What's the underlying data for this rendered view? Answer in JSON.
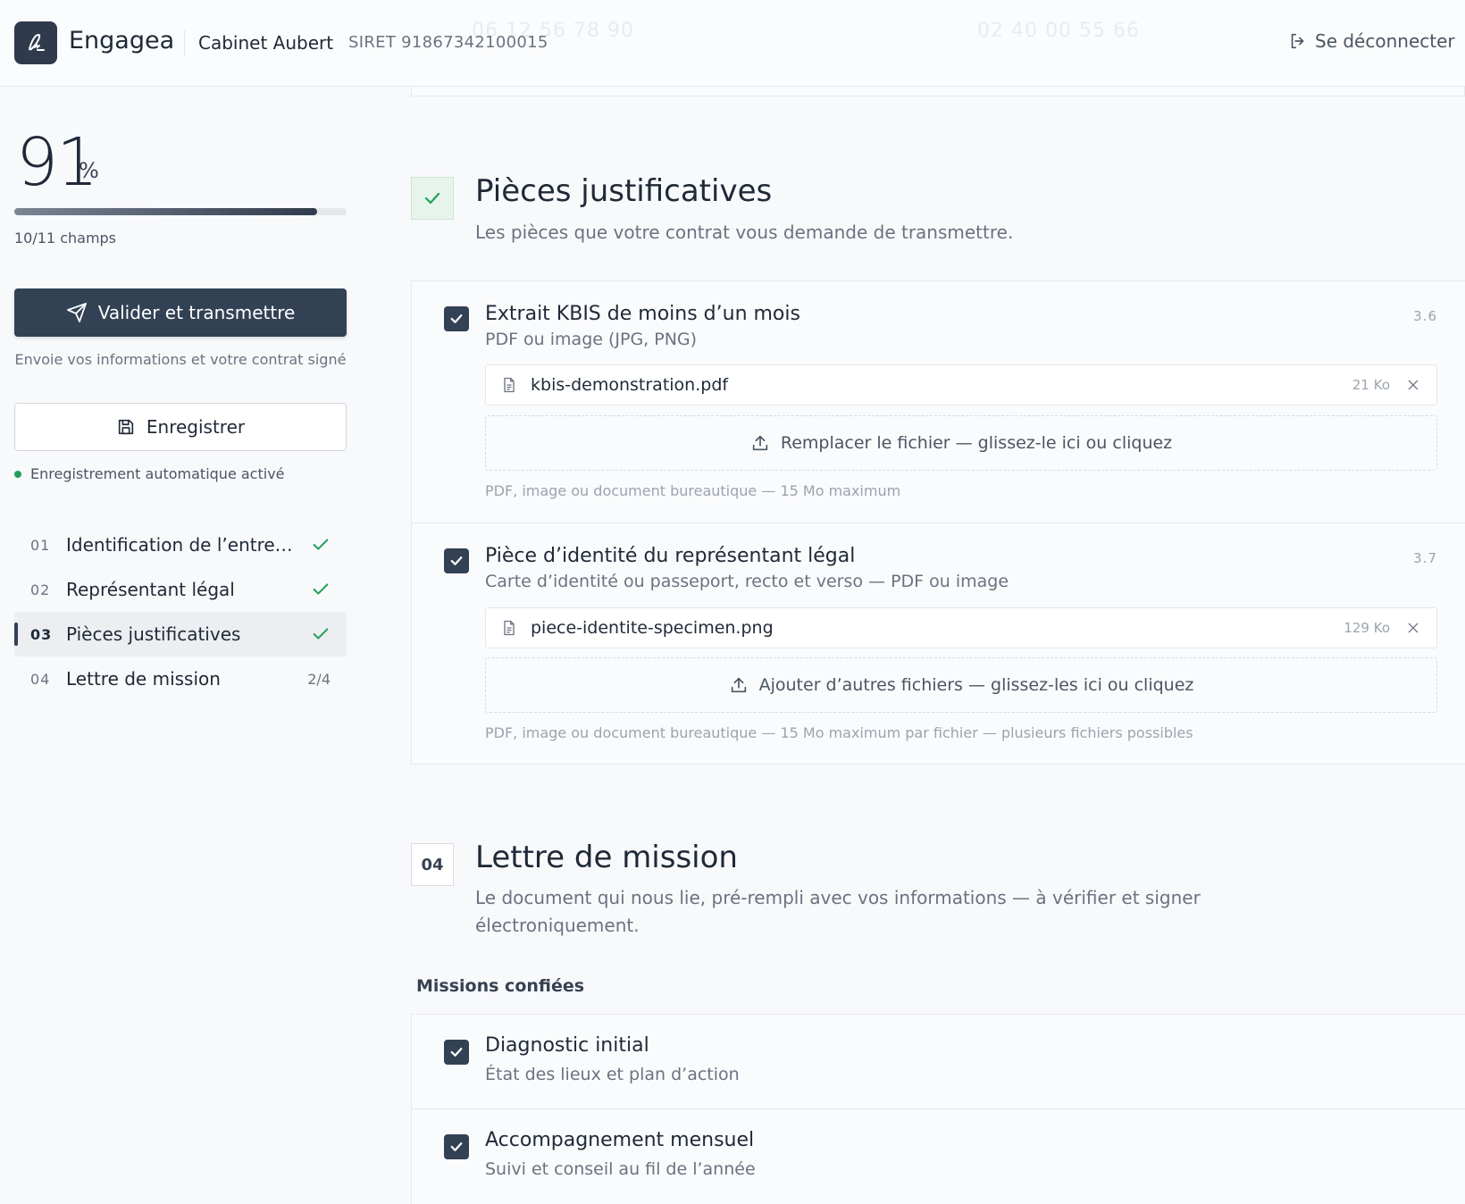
{
  "header": {
    "brand": "Engagea",
    "cabinet": "Cabinet Aubert",
    "siret": "SIRET 91867342100015",
    "logout_label": "Se déconnecter",
    "ghost_phone_1": "06 12 56 78 90",
    "ghost_phone_2": "02 40 00 55 66",
    "logo_icon": "signature-icon"
  },
  "sidebar": {
    "percent": "91",
    "percent_sign": "%",
    "progress_fraction": 0.91,
    "fields_count": "10/11 champs",
    "submit_label": "Valider et transmettre",
    "submit_note": "Envoie vos informations et votre contrat signé",
    "save_label": "Enregistrer",
    "autosave_label": "Enregistrement automatique activé",
    "nav": [
      {
        "num": "01",
        "label": "Identification de l’entrep...",
        "status": "done"
      },
      {
        "num": "02",
        "label": "Représentant légal",
        "status": "done"
      },
      {
        "num": "03",
        "label": "Pièces justificatives",
        "status": "done",
        "active": true
      },
      {
        "num": "04",
        "label": "Lettre de mission",
        "progress": "2/4"
      }
    ]
  },
  "sections": {
    "pieces": {
      "title": "Pièces justificatives",
      "subtitle": "Les pièces que votre contrat vous demande de transmettre.",
      "documents": [
        {
          "title": "Extrait KBIS de moins d’un mois",
          "subtitle": "PDF ou image (JPG, PNG)",
          "ref": "3.6",
          "file_name": "kbis-demonstration.pdf",
          "file_size": "21 Ko",
          "drop_label": "Remplacer le fichier — glissez-le ici ou cliquez",
          "hint": "PDF, image ou document bureautique — 15 Mo maximum"
        },
        {
          "title": "Pièce d’identité du représentant légal",
          "subtitle": "Carte d’identité ou passeport, recto et verso — PDF ou image",
          "ref": "3.7",
          "file_name": "piece-identite-specimen.png",
          "file_size": "129 Ko",
          "drop_label": "Ajouter d’autres fichiers — glissez-les ici ou cliquez",
          "hint": "PDF, image ou document bureautique — 15 Mo maximum par fichier — plusieurs fichiers possibles"
        }
      ]
    },
    "lettre": {
      "badge": "04",
      "title": "Lettre de mission",
      "subtitle_line1": "Le document qui nous lie, pré-rempli avec vos informations — à vérifier et signer",
      "subtitle_line2": "électroniquement.",
      "missions_label": "Missions confiées",
      "missions": [
        {
          "title": "Diagnostic initial",
          "subtitle": "État des lieux et plan d’action"
        },
        {
          "title": "Accompagnement mensuel",
          "subtitle": "Suivi et conseil au fil de l’année"
        }
      ]
    }
  },
  "colors": {
    "accent": "#334155",
    "success": "#22a05a",
    "background": "#f8f9fb"
  }
}
